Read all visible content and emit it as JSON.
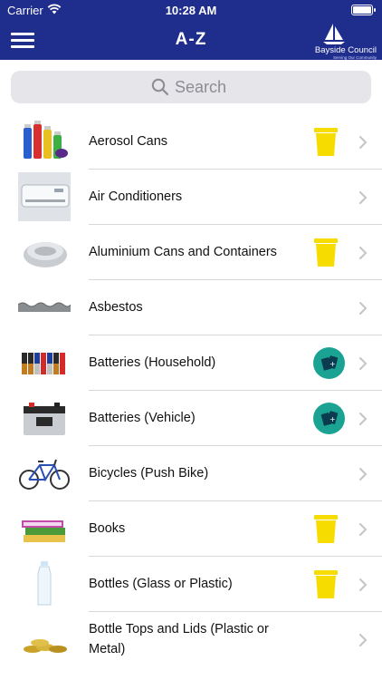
{
  "status": {
    "carrier": "Carrier",
    "time": "10:28 AM"
  },
  "header": {
    "title": "A-Z",
    "brand_name": "Bayside Council",
    "brand_tagline": "Serving Our Community",
    "bar_color": "#1f2d8c"
  },
  "search": {
    "placeholder": "Search"
  },
  "items": [
    {
      "label": "Aerosol Cans",
      "image": "aerosol-cans-image",
      "bin": "yellow-bin-icon"
    },
    {
      "label": "Air Conditioners",
      "image": "air-conditioner-image",
      "bin": null
    },
    {
      "label": "Aluminium Cans and Containers",
      "image": "aluminium-foil-image",
      "bin": "yellow-bin-icon"
    },
    {
      "label": "Asbestos",
      "image": "asbestos-sheet-image",
      "bin": null
    },
    {
      "label": "Batteries (Household)",
      "image": "household-batteries-image",
      "bin": "battery-recycling-icon"
    },
    {
      "label": "Batteries (Vehicle)",
      "image": "car-battery-image",
      "bin": "battery-recycling-icon"
    },
    {
      "label": "Bicycles (Push Bike)",
      "image": "bicycle-image",
      "bin": null
    },
    {
      "label": "Books",
      "image": "books-image",
      "bin": "yellow-bin-icon"
    },
    {
      "label": "Bottles (Glass or Plastic)",
      "image": "plastic-bottle-image",
      "bin": "yellow-bin-icon"
    },
    {
      "label": "Bottle Tops and Lids (Plastic or Metal)",
      "image": "bottle-caps-image",
      "bin": null
    }
  ],
  "colors": {
    "yellow_bin": "#f7dc00",
    "recycle_badge": "#1aa392",
    "chevron": "#c4c4c9"
  }
}
